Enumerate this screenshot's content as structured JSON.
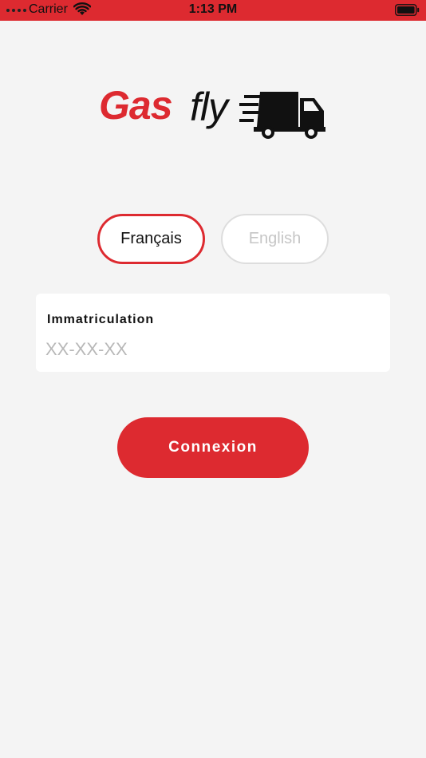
{
  "status_bar": {
    "carrier": "Carrier",
    "time": "1:13 PM",
    "wifi_icon": "wifi-icon",
    "battery_icon": "battery-icon"
  },
  "logo": {
    "part1": "Gas",
    "part2": "fly",
    "icon": "truck-icon"
  },
  "language": {
    "french_label": "Français",
    "english_label": "English",
    "selected": "Français"
  },
  "plate_field": {
    "label": "Immatriculation",
    "placeholder": "XX-XX-XX",
    "value": ""
  },
  "login": {
    "label": "Connexion"
  },
  "colors": {
    "brand_red": "#dd2a30",
    "background": "#f4f4f4",
    "inactive_text": "#c6c6c6"
  }
}
